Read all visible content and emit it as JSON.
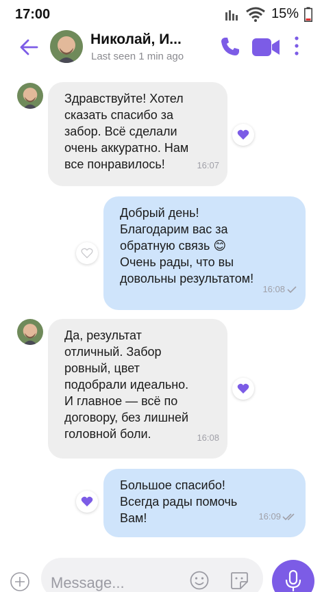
{
  "status": {
    "time": "17:00",
    "battery": "15%"
  },
  "header": {
    "contact_name": "Николай, И...",
    "last_seen": "Last seen 1 min ago"
  },
  "icons": {
    "back": "arrow-left-icon",
    "call": "phone-icon",
    "video": "video-camera-icon",
    "more": "more-vertical-icon",
    "plus": "plus-icon",
    "emoji": "emoji-icon",
    "sticker": "sticker-icon",
    "mic": "microphone-icon"
  },
  "colors": {
    "accent": "#7c5ce6",
    "bubble_in": "#eeeeee",
    "bubble_out": "#cfe4fb"
  },
  "messages": [
    {
      "direction": "in",
      "text": "Здравствуйте! Хотел\nсказать спасибо за\nзабор. Всё сделали\nочень аккуратно. Нам\nвсе понравилось!",
      "time": "16:07",
      "liked": true
    },
    {
      "direction": "out",
      "text": "Добрый день!\nБлагодарим вас за\nобратную связь 😊\nОчень рады, что вы\nдовольны результатом!",
      "time": "16:08",
      "status": "sent",
      "liked": false
    },
    {
      "direction": "in",
      "text": "Да, результат\nотличный. Забор\nровный, цвет\nподобрали идеально.\nИ главное — всё по\nдоговору, без лишней\nголовной боли.",
      "time": "16:08",
      "liked": true
    },
    {
      "direction": "out",
      "text": "Большое спасибо!\nВсегда рады помочь\nВам!",
      "time": "16:09",
      "status": "read",
      "liked": true
    }
  ],
  "composer": {
    "placeholder": "Message..."
  }
}
